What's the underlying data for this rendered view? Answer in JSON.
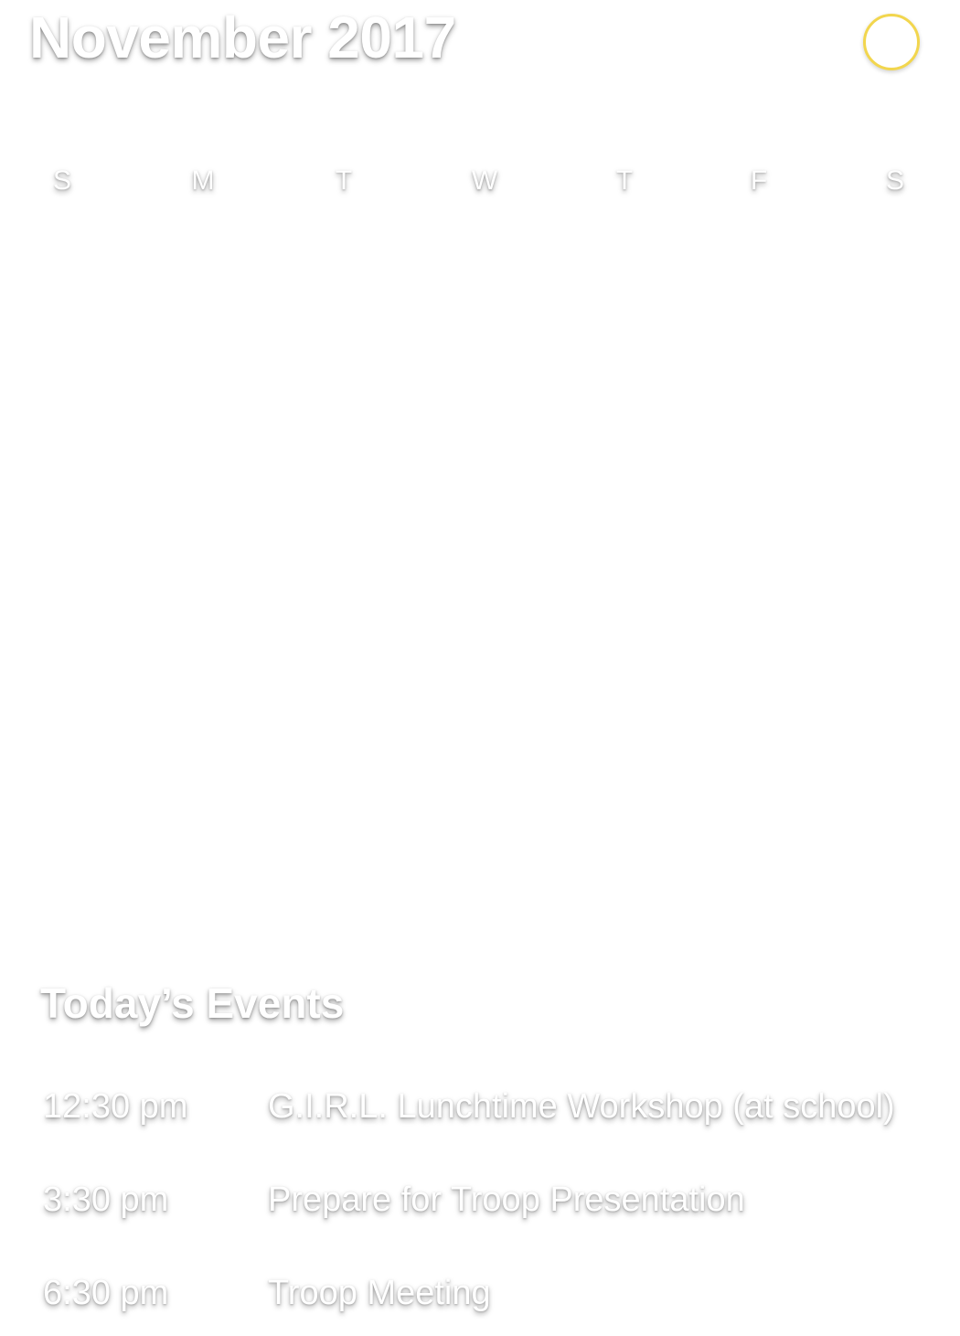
{
  "header": {
    "month_title": "November 2017",
    "close_icon": "close-icon",
    "accent_color": "#f2d64e"
  },
  "calendar": {
    "weekdays": [
      "S",
      "M",
      "T",
      "W",
      "T",
      "F",
      "S"
    ]
  },
  "events": {
    "heading": "Today’s Events",
    "items": [
      {
        "time": "12:30 pm",
        "title": "G.I.R.L. Lunchtime Workshop (at school)"
      },
      {
        "time": "3:30 pm",
        "title": "Prepare for Troop Presentation"
      },
      {
        "time": "6:30 pm",
        "title": "Troop Meeting"
      }
    ]
  }
}
